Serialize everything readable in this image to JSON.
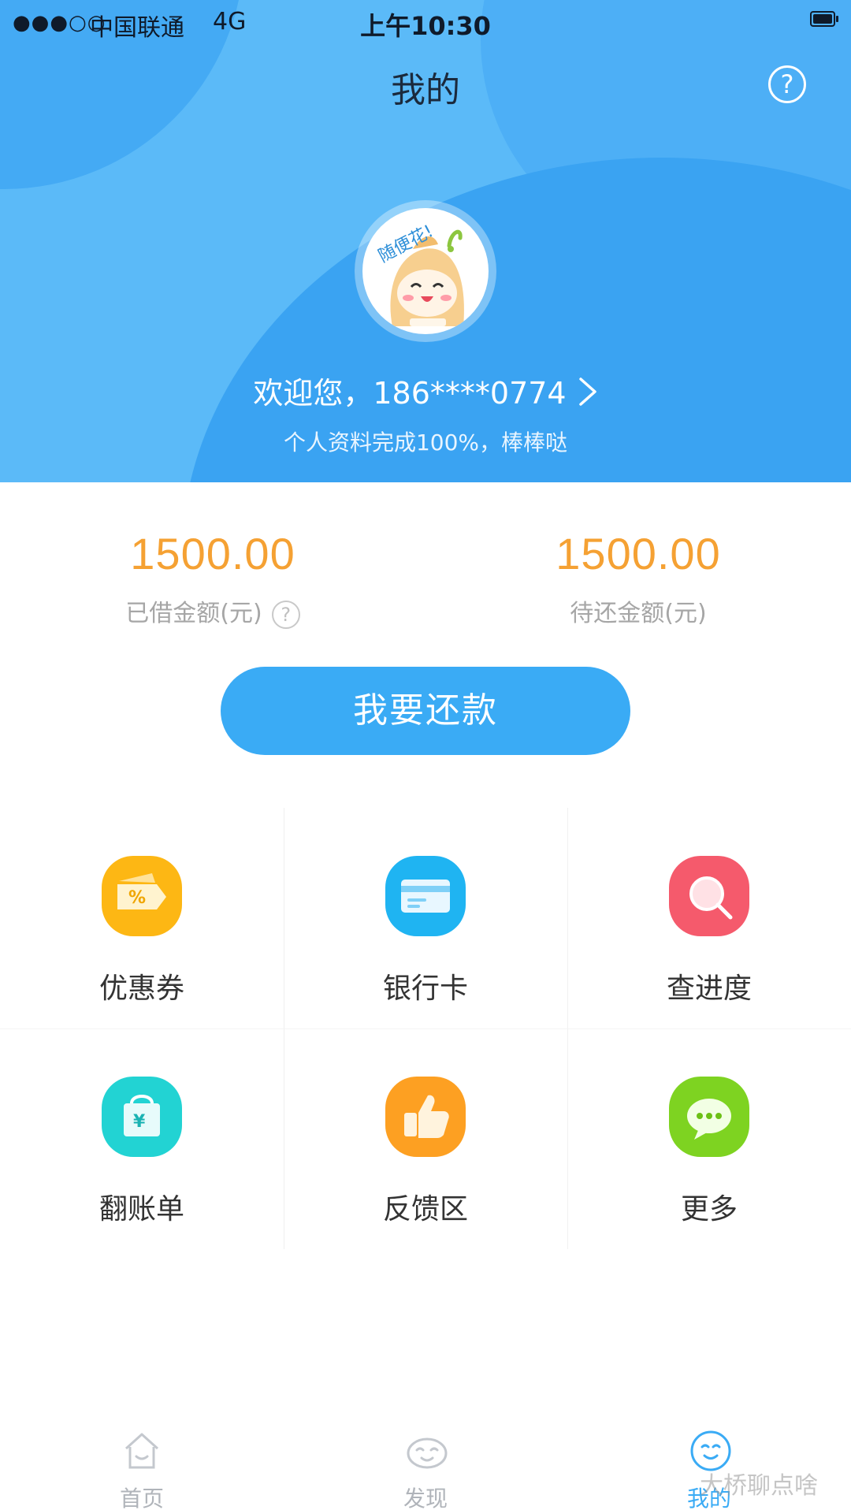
{
  "status_bar": {
    "signal": "●●●○○",
    "carrier": "中国联通",
    "network": "4G",
    "time": "上午10:30"
  },
  "header": {
    "title": "我的",
    "help_glyph": "?",
    "avatar_icon": "mascot-avatar-icon",
    "welcome": "欢迎您，186****0774",
    "profile_status": "个人资料完成100%，棒棒哒"
  },
  "amounts": {
    "borrowed_value": "1500.00",
    "borrowed_label": "已借金额(元)",
    "borrowed_help": "?",
    "pending_value": "1500.00",
    "pending_label": "待还金额(元)"
  },
  "repay_button": "我要还款",
  "grid": {
    "items": [
      {
        "label": "优惠券",
        "icon": "coupon-icon",
        "color": "#fdb714"
      },
      {
        "label": "银行卡",
        "icon": "bank-card-icon",
        "color": "#1fb4f2"
      },
      {
        "label": "查进度",
        "icon": "search-progress-icon",
        "color": "#f55a6c"
      },
      {
        "label": "翻账单",
        "icon": "bill-bag-icon",
        "color": "#22d3d3"
      },
      {
        "label": "反馈区",
        "icon": "thumbs-up-icon",
        "color": "#fda022"
      },
      {
        "label": "更多",
        "icon": "more-chat-icon",
        "color": "#7ed321"
      }
    ]
  },
  "tabbar": {
    "tabs": [
      {
        "label": "首页",
        "icon": "home-icon"
      },
      {
        "label": "发现",
        "icon": "discover-icon"
      },
      {
        "label": "我的",
        "icon": "profile-smile-icon",
        "active": true
      }
    ]
  },
  "watermark": "大桥聊点啥",
  "colors": {
    "header_blue": "#5bbaf8",
    "accent_blue": "#3aabf5",
    "amount_orange": "#f5a133"
  }
}
